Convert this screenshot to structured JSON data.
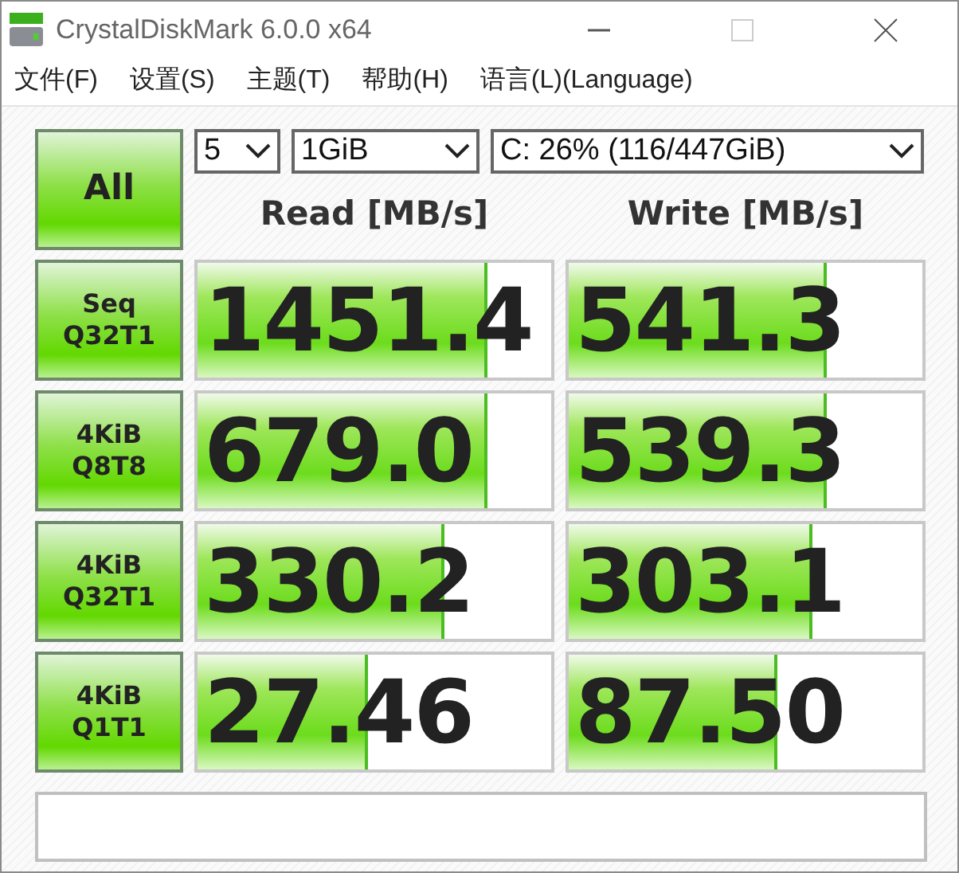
{
  "window": {
    "title": "CrystalDiskMark 6.0.0 x64"
  },
  "menu": [
    "文件(F)",
    "设置(S)",
    "主题(T)",
    "帮助(H)",
    "语言(L)(Language)"
  ],
  "all_button": "All",
  "selects": [
    {
      "value": "5"
    },
    {
      "value": "1GiB"
    },
    {
      "value": "C: 26% (116/447GiB)"
    }
  ],
  "columns": [
    "Read [MB/s]",
    "Write [MB/s]"
  ],
  "tests": [
    {
      "label": [
        "Seq",
        "Q32T1"
      ],
      "read": {
        "value": "1451.4",
        "level": 0.82
      },
      "write": {
        "value": "541.3",
        "level": 0.73
      }
    },
    {
      "label": [
        "4KiB",
        "Q8T8"
      ],
      "read": {
        "value": "679.0",
        "level": 0.82
      },
      "write": {
        "value": "539.3",
        "level": 0.73
      }
    },
    {
      "label": [
        "4KiB",
        "Q32T1"
      ],
      "read": {
        "value": "330.2",
        "level": 0.7
      },
      "write": {
        "value": "303.1",
        "level": 0.69
      }
    },
    {
      "label": [
        "4KiB",
        "Q1T1"
      ],
      "read": {
        "value": "27.46",
        "level": 0.48
      },
      "write": {
        "value": "87.50",
        "level": 0.59
      }
    }
  ]
}
